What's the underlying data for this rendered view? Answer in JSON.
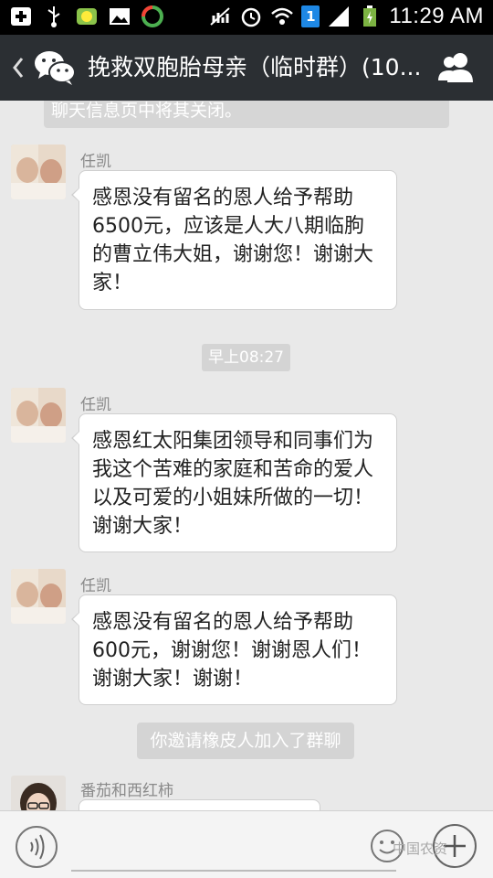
{
  "status_bar": {
    "time": "11:29 AM",
    "sim_slot": "1",
    "icons": [
      "add-icon",
      "usb-icon",
      "app-icon",
      "image-icon",
      "sync-icon",
      "no-signal-icon",
      "alarm-icon",
      "wifi-icon",
      "signal-icon",
      "battery-charging-icon"
    ]
  },
  "header": {
    "back_icon": "chevron-left-icon",
    "app_icon": "wechat-icon",
    "title": "挽救双胞胎母亲（临时群）(10...",
    "group_icon": "group-members-icon"
  },
  "chat": {
    "top_system_notice": "聊天信息页中将其关闭。",
    "messages": [
      {
        "sender": "任凯",
        "text": "感恩没有留名的恩人给予帮助6500元，应该是人大八期临朐的曹立伟大姐，谢谢您！谢谢大家！"
      },
      {
        "timestamp": "早上08:27"
      },
      {
        "sender": "任凯",
        "text": "感恩红太阳集团领导和同事们为我这个苦难的家庭和苦命的爱人以及可爱的小姐妹所做的一切！谢谢大家！"
      },
      {
        "sender": "任凯",
        "text": "感恩没有留名的恩人给予帮助600元，谢谢您！谢谢恩人们！谢谢大家！谢谢！"
      },
      {
        "system": "你邀请橡皮人加入了群聊"
      },
      {
        "sender": "番茄和西红柿",
        "text": ""
      }
    ]
  },
  "input_bar": {
    "voice_icon": "voice-icon",
    "emoji_icon": "emoji-icon",
    "plus_icon": "plus-icon",
    "input_value": "",
    "watermark": "中国农资"
  },
  "colors": {
    "header_bg": "#2b2f33",
    "chat_bg": "#e9e9e9",
    "bubble_bg": "#ffffff",
    "system_bg": "#d4d4d4"
  }
}
